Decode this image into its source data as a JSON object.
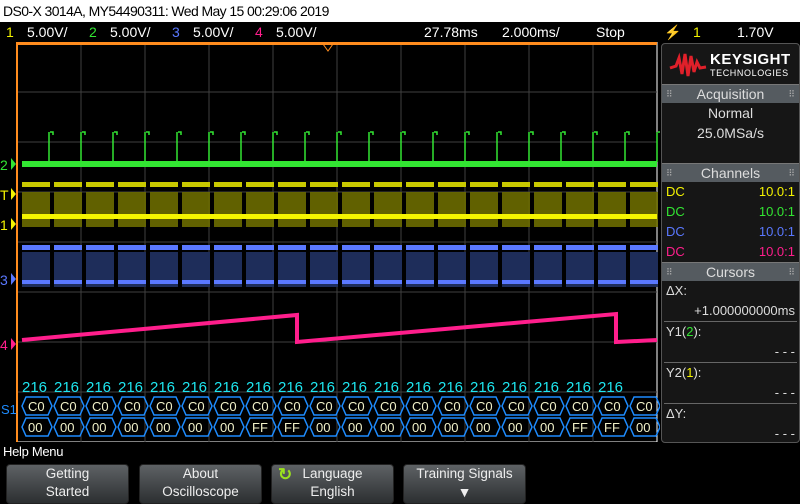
{
  "title": "DS0-X 3014A, MY54490311: Wed May 15 00:29:06 2019",
  "status": {
    "channels": [
      {
        "num": "1",
        "scale": "5.00V/",
        "color": "#f4f400"
      },
      {
        "num": "2",
        "scale": "5.00V/",
        "color": "#32e632"
      },
      {
        "num": "3",
        "scale": "5.00V/",
        "color": "#5a78ff"
      },
      {
        "num": "4",
        "scale": "5.00V/",
        "color": "#ff1e8c"
      }
    ],
    "delay": "27.78ms",
    "timebase": "2.000ms/",
    "run_state": "Stop",
    "trigger_source": "1",
    "trigger_level": "1.70V"
  },
  "markers": {
    "ch2": "2",
    "trig": "T",
    "ch1": "1",
    "ch3": "3",
    "ch4": "4",
    "serial": "S1"
  },
  "decode": {
    "labels": [
      "216",
      "216",
      "216",
      "216",
      "216",
      "216",
      "216",
      "216",
      "216",
      "216",
      "216",
      "216",
      "216",
      "216",
      "216",
      "216",
      "216",
      "216",
      "216"
    ],
    "row1": [
      "C0",
      "C0",
      "C0",
      "C0",
      "C0",
      "C0",
      "C0",
      "C0",
      "C0",
      "C0",
      "C0",
      "C0",
      "C0",
      "C0",
      "C0",
      "C0",
      "C0",
      "C0",
      "C0",
      "C0"
    ],
    "row2": [
      "00",
      "00",
      "00",
      "00",
      "00",
      "00",
      "00",
      "FF",
      "FF",
      "00",
      "00",
      "00",
      "00",
      "00",
      "00",
      "00",
      "00",
      "FF",
      "FF",
      "00"
    ]
  },
  "side": {
    "brand": "KEYSIGHT",
    "brand_sub": "TECHNOLOGIES",
    "acq_title": "Acquisition",
    "acq_mode": "Normal",
    "acq_rate": "25.0MSa/s",
    "ch_title": "Channels",
    "ch": [
      {
        "coupling": "DC",
        "probe": "10.0:1"
      },
      {
        "coupling": "DC",
        "probe": "10.0:1"
      },
      {
        "coupling": "DC",
        "probe": "10.0:1"
      },
      {
        "coupling": "DC",
        "probe": "10.0:1"
      }
    ],
    "cur_title": "Cursors",
    "dx_label": "ΔX:",
    "dx": "+1.000000000ms",
    "y1_label": "Y1(",
    "y1_src": "2",
    "y1_end": "):",
    "y1": "- - -",
    "y2_label": "Y2(",
    "y2_src": "1",
    "y2_end": "):",
    "y2": "- - -",
    "dy_label": "ΔY:",
    "dy": "- - -"
  },
  "menu": {
    "title": "Help Menu",
    "buttons": [
      {
        "l1": "Getting",
        "l2": "Started"
      },
      {
        "l1": "About",
        "l2": "Oscilloscope"
      },
      {
        "l1": "Language",
        "l2": "English"
      },
      {
        "l1": "Training Signals",
        "l2": ""
      }
    ]
  },
  "colors": {
    "grid": "#404040",
    "orange": "#ff8c1e",
    "decode": "#1e8cff",
    "label": "#1ee6f0"
  }
}
